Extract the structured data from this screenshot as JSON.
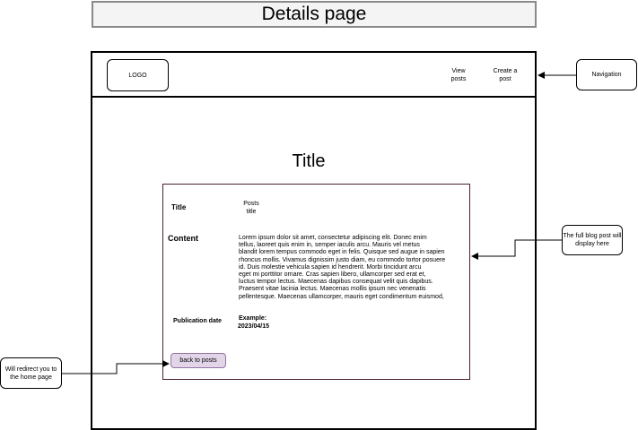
{
  "page_banner": "Details page",
  "header": {
    "logo": "LOGO",
    "nav": [
      {
        "label": "View\nposts"
      },
      {
        "label": "Create a\npost"
      }
    ]
  },
  "main": {
    "title": "Title",
    "card": {
      "title_label": "Title",
      "title_value": "Posts\ntitle",
      "content_label": "Content",
      "content_lines": [
        "Lorem ipsum dolor sit amet, consectetur adipiscing elit. Donec enim",
        "tellus, laoreet quis enim in, semper iaculis arcu. Mauris vel metus",
        "blandit lorem tempus commodo eget in felis. Quisque sed augue in sapien",
        "rhoncus mollis. Vivamus dignissim justo diam, eu commodo tortor posuere",
        "id. Duis molestie vehicula sapien id hendrerit. Morbi tincidunt arcu",
        "eget mi porttitor ornare. Cras sapien libero, ullamcorper sed erat et,",
        "luctus tempor lectus. Maecenas dapibus consequat velit quis dapibus.",
        "Praesent vitae lacinia lectus. Maecenas mollis ipsum nec venenatis",
        "pellentesque. Maecenas ullamcorper, mauris eget condimentum euismod,"
      ],
      "pubdate_label": "Publication date",
      "pubdate_example_label": "Example:",
      "pubdate_example_value": "2023/04/15",
      "back_button": "back to posts"
    }
  },
  "annotations": {
    "navigation": "Navigation",
    "full_post": "The full blog post will\ndisplay here",
    "redirect": "Will redirect you to\nthe home page"
  },
  "colors": {
    "back_button_fill": "#e1d5e7",
    "back_button_border": "#9673a6",
    "card_border": "#4a1f2a",
    "banner_fill": "#f4f4f4"
  }
}
